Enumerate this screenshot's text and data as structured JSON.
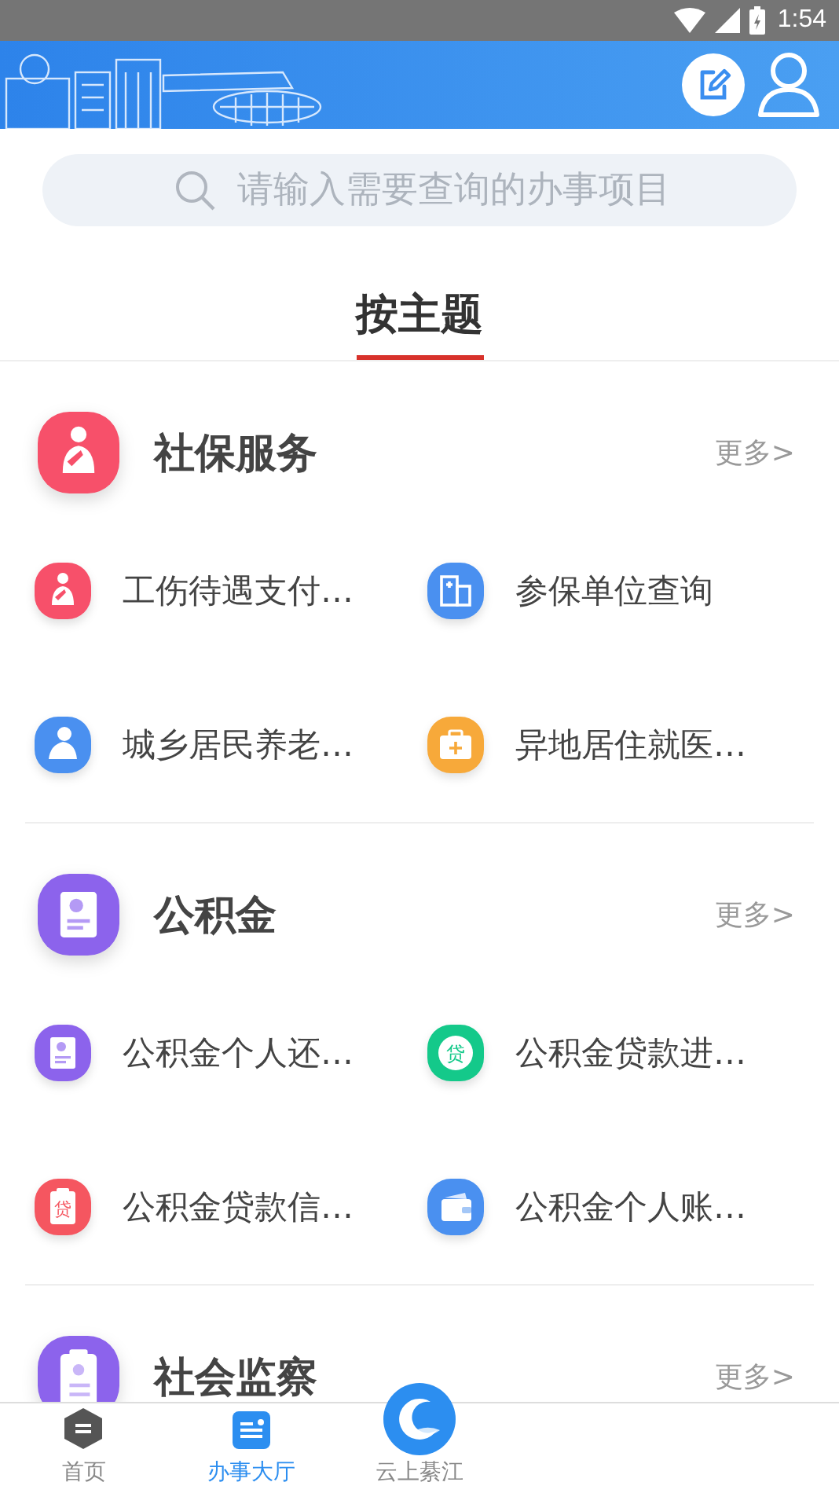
{
  "status_bar": {
    "time": "1:54"
  },
  "search": {
    "placeholder": "请输入需要查询的办事项目"
  },
  "tabs": [
    {
      "label": "按主题",
      "selected": true
    }
  ],
  "sections": [
    {
      "title": "社保服务",
      "kind": "injury",
      "color": "#f7506a",
      "more": "更多>",
      "items": [
        {
          "label": "工伤待遇支付…",
          "kind": "injury",
          "color": "#f7506a"
        },
        {
          "label": "参保单位查询",
          "kind": "building",
          "color": "#4a90f0"
        },
        {
          "label": "城乡居民养老…",
          "kind": "elder",
          "color": "#4a90f0"
        },
        {
          "label": "异地居住就医…",
          "kind": "medkit",
          "color": "#f7a93a"
        }
      ]
    },
    {
      "title": "公积金",
      "kind": "document",
      "color": "#8c63ec",
      "more": "更多>",
      "items": [
        {
          "label": "公积金个人还…",
          "kind": "document",
          "color": "#8c63ec"
        },
        {
          "label": "公积金贷款进…",
          "kind": "loan",
          "color": "#14c98a",
          "badge": "贷"
        },
        {
          "label": "公积金贷款信…",
          "kind": "loan-form",
          "color": "#f55660",
          "badge": "贷"
        },
        {
          "label": "公积金个人账…",
          "kind": "wallet",
          "color": "#4a90f0"
        }
      ]
    },
    {
      "title": "社会监察",
      "kind": "clipboard",
      "color": "#8c63ec",
      "more": "更多>"
    }
  ],
  "nav": [
    {
      "label": "首页",
      "kind": "home",
      "selected": false
    },
    {
      "label": "办事大厅",
      "kind": "hall",
      "selected": true
    },
    {
      "label": "云上綦江",
      "kind": "logo",
      "selected": false
    }
  ]
}
